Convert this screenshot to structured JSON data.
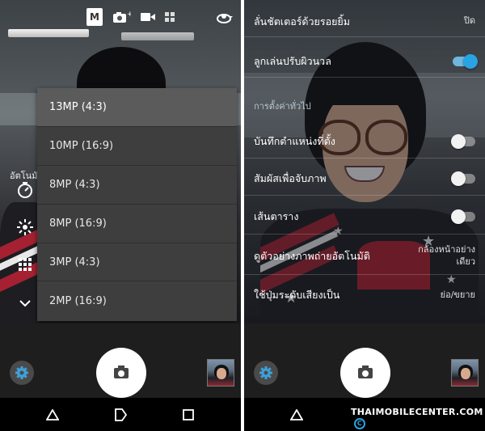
{
  "left_panel": {
    "toolbar": {
      "mode_label": "M",
      "icons": [
        "photo-mode-icon",
        "video-mode-icon",
        "more-icon",
        "switch-camera-icon"
      ]
    },
    "side_label": "อัตโนมั",
    "side_icons": [
      "timer-icon",
      "flash-icon",
      "grid-icon",
      "chevron-down-icon"
    ],
    "resolution_menu": {
      "selected": "13MP (4:3)",
      "options": [
        "13MP (4:3)",
        "10MP (16:9)",
        "8MP (4:3)",
        "8MP (16:9)",
        "3MP (4:3)",
        "2MP (16:9)"
      ]
    }
  },
  "right_panel": {
    "settings": [
      {
        "label": "ลั่นชัตเตอร์ด้วยรอยยิ้ม",
        "value": "ปิด"
      },
      {
        "label": "ลูกเล่นปรับผิวนวล",
        "toggle": true
      }
    ],
    "section_header": "การตั้งค่าทั่วไป",
    "general_settings": [
      {
        "label": "บันทึกตำแหน่งที่ตั้ง",
        "toggle": false
      },
      {
        "label": "สัมผัสเพื่อจับภาพ",
        "toggle": false
      },
      {
        "label": "เส้นตาราง",
        "toggle": false
      },
      {
        "label": "ดูตัวอย่างภาพถ่ายอัตโนมัติ",
        "value": "กล้องหน้าอย่างเดียว"
      },
      {
        "label": "ใช้ปุ่มระดับเสียงเป็น",
        "value": "ย่อ/ขยาย"
      }
    ],
    "watermark": "THAIMOBILECENTER.COM",
    "watermark_mark": "C"
  },
  "colors": {
    "accent": "#29a3e3",
    "menu_bg": "#3e3e3e",
    "menu_selected": "#5b5b5b",
    "controls_bg": "#1e1e1e",
    "navbar_bg": "#000000"
  }
}
